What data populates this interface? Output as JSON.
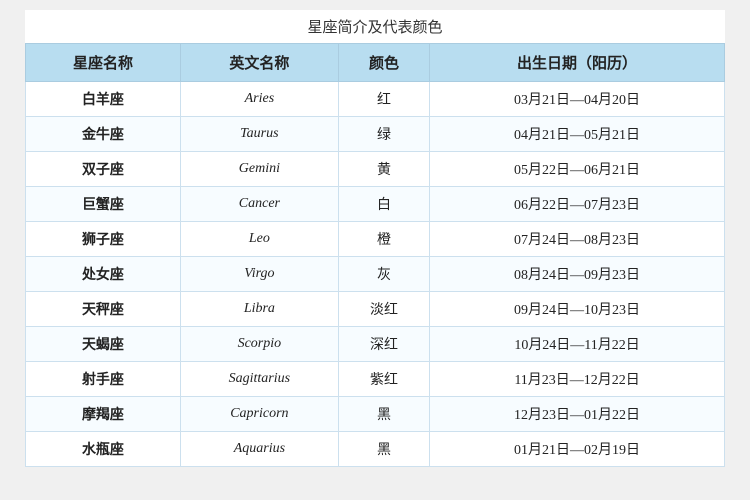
{
  "title": "星座简介及代表颜色",
  "table": {
    "headers": [
      "星座名称",
      "英文名称",
      "颜色",
      "出生日期（阳历）"
    ],
    "rows": [
      [
        "白羊座",
        "Aries",
        "红",
        "03月21日—04月20日"
      ],
      [
        "金牛座",
        "Taurus",
        "绿",
        "04月21日—05月21日"
      ],
      [
        "双子座",
        "Gemini",
        "黄",
        "05月22日—06月21日"
      ],
      [
        "巨蟹座",
        "Cancer",
        "白",
        "06月22日—07月23日"
      ],
      [
        "狮子座",
        "Leo",
        "橙",
        "07月24日—08月23日"
      ],
      [
        "处女座",
        "Virgo",
        "灰",
        "08月24日—09月23日"
      ],
      [
        "天秤座",
        "Libra",
        "淡红",
        "09月24日—10月23日"
      ],
      [
        "天蝎座",
        "Scorpio",
        "深红",
        "10月24日—11月22日"
      ],
      [
        "射手座",
        "Sagittarius",
        "紫红",
        "11月23日—12月22日"
      ],
      [
        "摩羯座",
        "Capricorn",
        "黑",
        "12月23日—01月22日"
      ],
      [
        "水瓶座",
        "Aquarius",
        "黑",
        "01月21日—02月19日"
      ]
    ]
  }
}
